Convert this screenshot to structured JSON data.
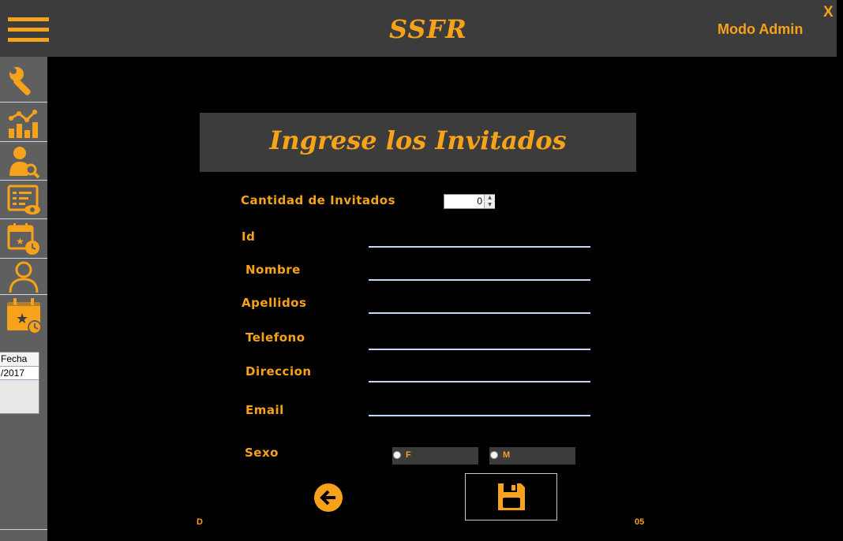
{
  "header": {
    "app_title": "SSFR",
    "mode": "Modo Admin",
    "close_label": "X"
  },
  "sidebar": {
    "items": [
      {
        "icon": "wrench-icon"
      },
      {
        "icon": "statistics-icon"
      },
      {
        "icon": "user-search-icon"
      },
      {
        "icon": "list-view-icon"
      },
      {
        "icon": "calendar-clock-icon"
      },
      {
        "icon": "user-icon"
      },
      {
        "icon": "event-calendar-icon"
      }
    ],
    "table": {
      "header": "Fecha",
      "rows": [
        "/2017"
      ]
    }
  },
  "form": {
    "title": "Ingrese los Invitados",
    "cantidad_label": "Cantidad de Invitados",
    "cantidad_value": "0",
    "id_label": "Id",
    "nombre_label": "Nombre",
    "apellidos_label": "Apellidos",
    "telefono_label": "Telefono",
    "direccion_label": "Direccion",
    "email_label": "Email",
    "sexo_label": "Sexo",
    "sexo_options": [
      "F",
      "M"
    ],
    "fields": {
      "id": "",
      "nombre": "",
      "apellidos": "",
      "telefono": "",
      "direccion": "",
      "email": ""
    },
    "partial_left": "D",
    "partial_right": "05"
  },
  "colors": {
    "accent": "#f7a21b",
    "bar": "#3c3c3c",
    "sidebar": "#5f5f5f",
    "background": "#000000"
  }
}
